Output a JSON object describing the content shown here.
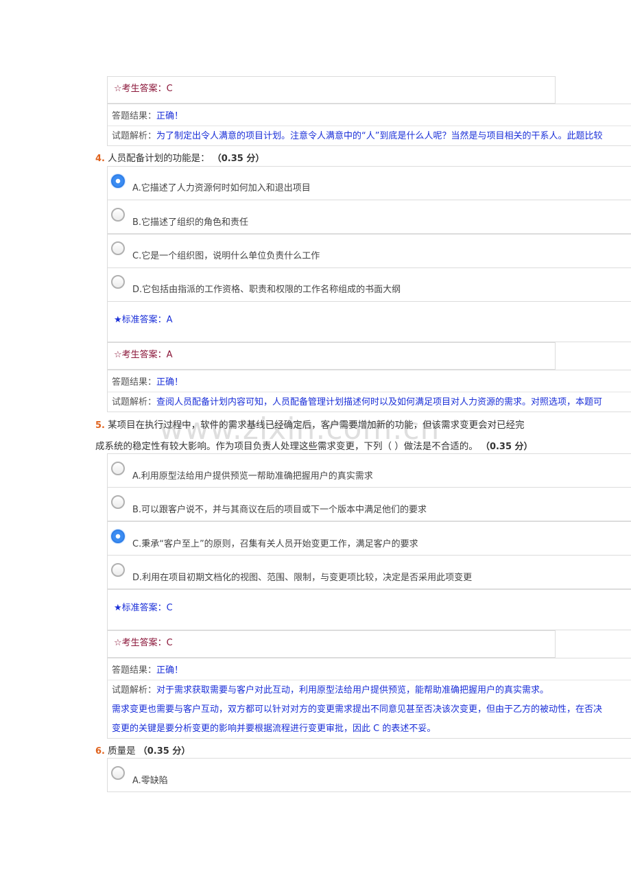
{
  "watermark": "www.zixin.com.cn",
  "q3_tail": {
    "student_answer": "☆考生答案：C",
    "result_label": "答题结果：",
    "result_value": "正确！",
    "analysis_label": "试题解析：",
    "analysis": "为了制定出令人满意的项目计划。注意令人满意中的“人”到底是什么人呢？当然是与项目相关的干系人。此题比较"
  },
  "q4": {
    "number": "4.",
    "text": "人员配备计划的功能是：",
    "score": "（0.35 分）",
    "options": [
      {
        "text": "A.它描述了人力资源何时如何加入和退出项目",
        "selected": true
      },
      {
        "text": "B.它描述了组织的角色和责任",
        "selected": false
      },
      {
        "text": "C.它是一个组织图，说明什么单位负责什么工作",
        "selected": false
      },
      {
        "text": "D.它包括由指派的工作资格、职责和权限的工作名称组成的书面大纲",
        "selected": false
      }
    ],
    "standard_answer": "★标准答案：A",
    "student_answer": "☆考生答案：A",
    "result_label": "答题结果：",
    "result_value": "正确！",
    "analysis_label": "试题解析：",
    "analysis": "查阅人员配备计划内容可知，人员配备管理计划描述何时以及如何满足项目对人力资源的需求。对照选项，本题可"
  },
  "q5": {
    "number": "5.",
    "text_line1": "某项目在执行过程中，软件的需求基线已经确定后，客户需要增加新的功能，但该需求变更会对已经完",
    "text_line2": "成系统的稳定性有较大影响。作为项目负责人处理这些需求变更，下列（ ）做法是不合适的。",
    "score": "（0.35 分）",
    "options": [
      {
        "text": "A.利用原型法给用户提供预览一帮助准确把握用户的真实需求",
        "selected": false
      },
      {
        "text": "B.可以跟客户说不，并与其商议在后的项目或下一个版本中满足他们的要求",
        "selected": false
      },
      {
        "text": "C.秉承“客户至上”的原则，召集有关人员开始变更工作，满足客户的要求",
        "selected": true
      },
      {
        "text": "D.利用在项目初期文档化的视图、范围、限制，与变更项比较，决定是否采用此项变更",
        "selected": false
      }
    ],
    "standard_answer": "★标准答案：C",
    "student_answer": "☆考生答案：C",
    "result_label": "答题结果：",
    "result_value": "正确！",
    "analysis_label": "试题解析：",
    "analysis_line1": "对于需求获取需要与客户对此互动，利用原型法给用户提供预览，能帮助准确把握用户的真实需求。",
    "analysis_line2": "需求变更也需要与客户互动，双方都可以针对对方的变更需求提出不同意见甚至否决该次变更，但由于乙方的被动性，在否决",
    "analysis_line3": "变更的关键是要分析变更的影响并要根据流程进行变更审批，因此 C 的表述不妥。"
  },
  "q6": {
    "number": "6.",
    "text": "质量是",
    "score": "（0.35 分）",
    "options": [
      {
        "text": "A.零缺陷",
        "selected": false
      }
    ]
  }
}
